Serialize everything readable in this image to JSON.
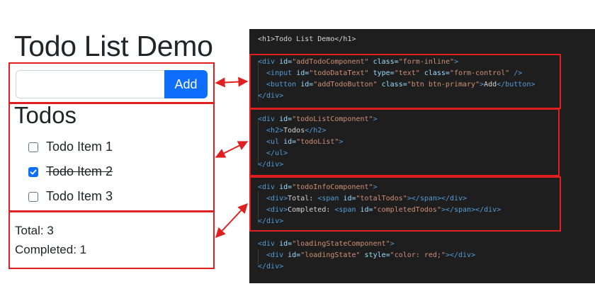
{
  "demo": {
    "title": "Todo List Demo",
    "input": {
      "value": "",
      "placeholder": ""
    },
    "add_label": "Add",
    "todos_heading": "Todos",
    "items": [
      {
        "label": "Todo Item 1",
        "checked": false
      },
      {
        "label": "Todo Item 2",
        "checked": true
      },
      {
        "label": "Todo Item 3",
        "checked": false
      }
    ],
    "total_line": "Total: 3",
    "completed_line": "Completed: 1"
  },
  "code": {
    "lines": [
      {
        "x": "<h1>Todo List Demo</h1>"
      },
      {
        "t1": "<div",
        "a1": " id=",
        "s1": "\"addTodoComponent\"",
        "a2": " class=",
        "s2": "\"form-inline\"",
        "t2": ">"
      },
      {
        "t1": "  <input",
        "a1": " id=",
        "s1": "\"todoDataText\"",
        "a2": " type=",
        "s2": "\"text\"",
        "a3": " class=",
        "s3": "\"form-control\"",
        "t2": " />"
      },
      {
        "t1": "  <button",
        "a1": " id=",
        "s1": "\"addTodoButton\"",
        "a2": " class=",
        "s2": "\"btn btn-primary\"",
        "t2": ">",
        "x": "Add",
        "t3": "</button>"
      },
      {
        "t1": "</div>"
      },
      {
        "t1": "<div",
        "a1": " id=",
        "s1": "\"todoListComponent\"",
        "t2": ">"
      },
      {
        "t1": "  <h2>",
        "x": "Todos",
        "t2": "</h2>"
      },
      {
        "t1": "  <ul",
        "a1": " id=",
        "s1": "\"todoList\"",
        "t2": ">"
      },
      {
        "t1": "  </ul>"
      },
      {
        "t1": "</div>"
      },
      {
        "t1": "<div",
        "a1": " id=",
        "s1": "\"todoInfoComponent\"",
        "t2": ">"
      },
      {
        "t1": "  <div>",
        "x": "Total: ",
        "t2": "<span",
        "a1": " id=",
        "s1": "\"totalTodos\"",
        "t3": "></span></div>"
      },
      {
        "t1": "  <div>",
        "x": "Completed: ",
        "t2": "<span",
        "a1": " id=",
        "s1": "\"completedTodos\"",
        "t3": "></span></div>"
      },
      {
        "t1": "</div>"
      },
      {
        "t1": "<div",
        "a1": " id=",
        "s1": "\"loadingStateComponent\"",
        "t2": ">"
      },
      {
        "t1": "  <div",
        "a1": " id=",
        "s1": "\"loadingState\"",
        "a2": " style=",
        "s2": "\"color: red;\"",
        "t2": "></div>"
      },
      {
        "t1": "</div>"
      }
    ]
  },
  "colors": {
    "highlight_border": "#e02020",
    "button_primary": "#0d6efd",
    "code_background": "#1e1e1e",
    "code_tag": "#569cd6",
    "code_attr": "#9cdcfe",
    "code_string": "#ce9178"
  }
}
